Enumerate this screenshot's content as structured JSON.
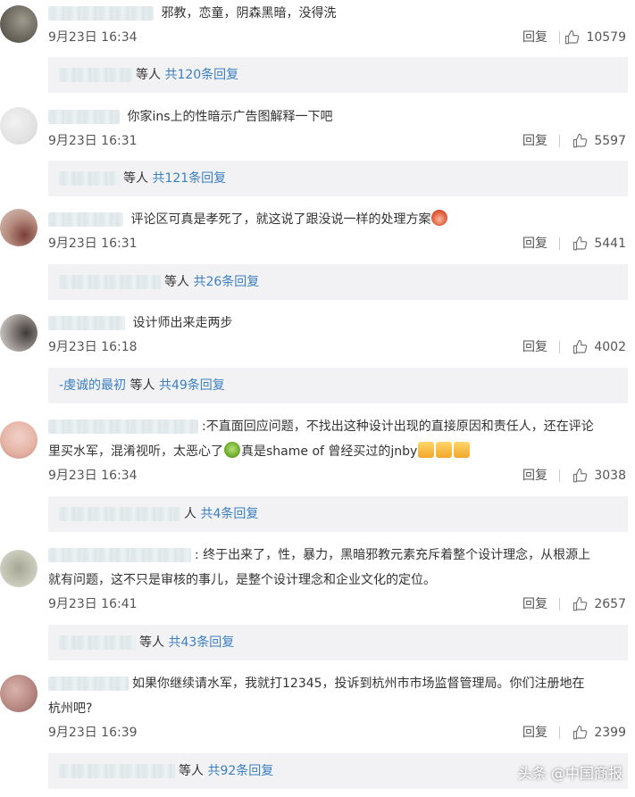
{
  "comments": [
    {
      "text": "邪教，恋童，阴森黑暗，没得洗",
      "time": "9月23日 16:34",
      "reply_label": "回复",
      "likes": "10579",
      "thread_suffix": "等人",
      "thread_link": "共120条回复"
    },
    {
      "text": "你家ins上的性暗示广告图解释一下吧",
      "time": "9月23日 16:31",
      "reply_label": "回复",
      "likes": "5597",
      "thread_suffix": "等人",
      "thread_link": "共121条回复"
    },
    {
      "text": "评论区可真是孝死了，就这说了跟没说一样的处理方案",
      "time": "9月23日 16:31",
      "reply_label": "回复",
      "likes": "5441",
      "thread_suffix": "等人",
      "thread_link": "共26条回复"
    },
    {
      "text": "设计师出来走两步",
      "time": "9月23日 16:18",
      "reply_label": "回复",
      "likes": "4002",
      "thread_name": "-虔诚的最初",
      "thread_suffix": "等人",
      "thread_link": "共49条回复"
    },
    {
      "text_line1": ":不直面回应问题，不找出这种设计出现的直接原因和责任人，还在评论",
      "text_line2a": "里买水军，混淆视听，太恶心了",
      "text_line2b": "真是shame of 曾经买过的jnby",
      "time": "9月23日 16:34",
      "reply_label": "回复",
      "likes": "3038",
      "thread_suffix": "人",
      "thread_link": "共4条回复"
    },
    {
      "text_line1": ": 终于出来了，性，暴力，黑暗邪教元素充斥着整个设计理念，从根源上",
      "text_line2": "就有问题，这不只是审核的事儿，是整个设计理念和企业文化的定位。",
      "time": "9月23日 16:41",
      "reply_label": "回复",
      "likes": "2657",
      "thread_suffix": "等人",
      "thread_link": "共43条回复"
    },
    {
      "text_line1": "如果你继续请水军，我就打12345，投诉到杭州市市场监督管理局。你们注册地在",
      "text_line2": "杭州吧?",
      "time": "9月23日 16:39",
      "reply_label": "回复",
      "likes": "2399",
      "thread_suffix": "等人",
      "thread_link": "共92条回复"
    }
  ],
  "watermark": {
    "text": "头条 @中国商报",
    "icon": "toutiao-logo-icon"
  },
  "icons": {
    "like": "thumbs-up-icon"
  },
  "colors": {
    "link": "#3a7fbf",
    "thread_bg": "#f2f2f5",
    "text": "#333333"
  }
}
